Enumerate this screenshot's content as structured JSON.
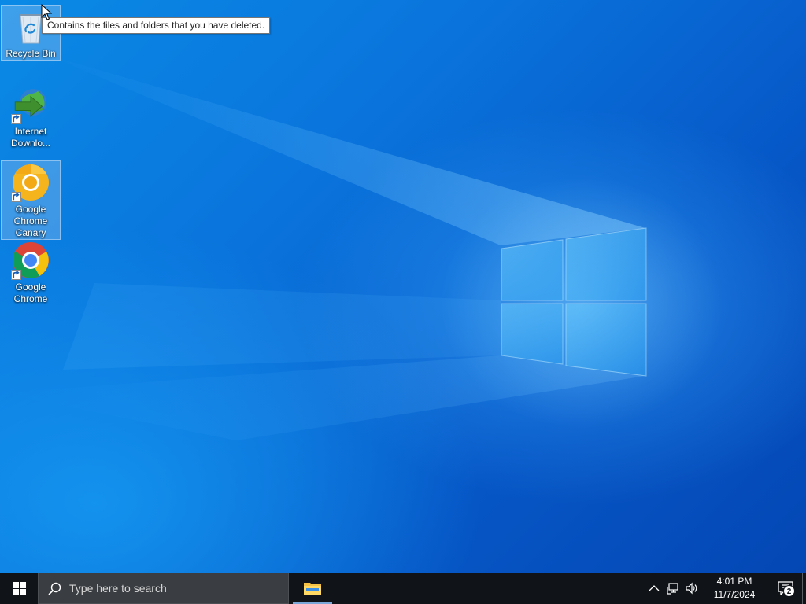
{
  "desktop": {
    "icons": [
      {
        "id": "recycle-bin",
        "label": "Recycle Bin",
        "icon": "recycle-bin-icon",
        "selected": true
      },
      {
        "id": "internet-download-manager",
        "label": "Internet Downlo...",
        "icon": "idm-globe-icon",
        "shortcut": true
      },
      {
        "id": "google-chrome-canary",
        "label": "Google Chrome Canary",
        "icon": "chrome-canary-icon",
        "shortcut": true,
        "selected": true
      },
      {
        "id": "google-chrome",
        "label": "Google Chrome",
        "icon": "chrome-icon",
        "shortcut": true
      }
    ],
    "tooltip": "Contains the files and folders that you have deleted."
  },
  "taskbar": {
    "start_icon": "windows-logo-icon",
    "search": {
      "placeholder": "Type here to search",
      "icon": "search-icon"
    },
    "pinned_apps": [
      {
        "name": "File Explorer",
        "icon": "folder-icon",
        "active": true
      }
    ],
    "tray": {
      "icons": [
        "chevron-up-icon",
        "network-icon",
        "volume-icon"
      ],
      "time": "4:01 PM",
      "date": "11/7/2024",
      "notification_count": "2"
    }
  },
  "colors": {
    "taskbar_bg": "#101419",
    "search_bg": "#3a3d41",
    "wallpaper_blue": "#0a74dc"
  }
}
